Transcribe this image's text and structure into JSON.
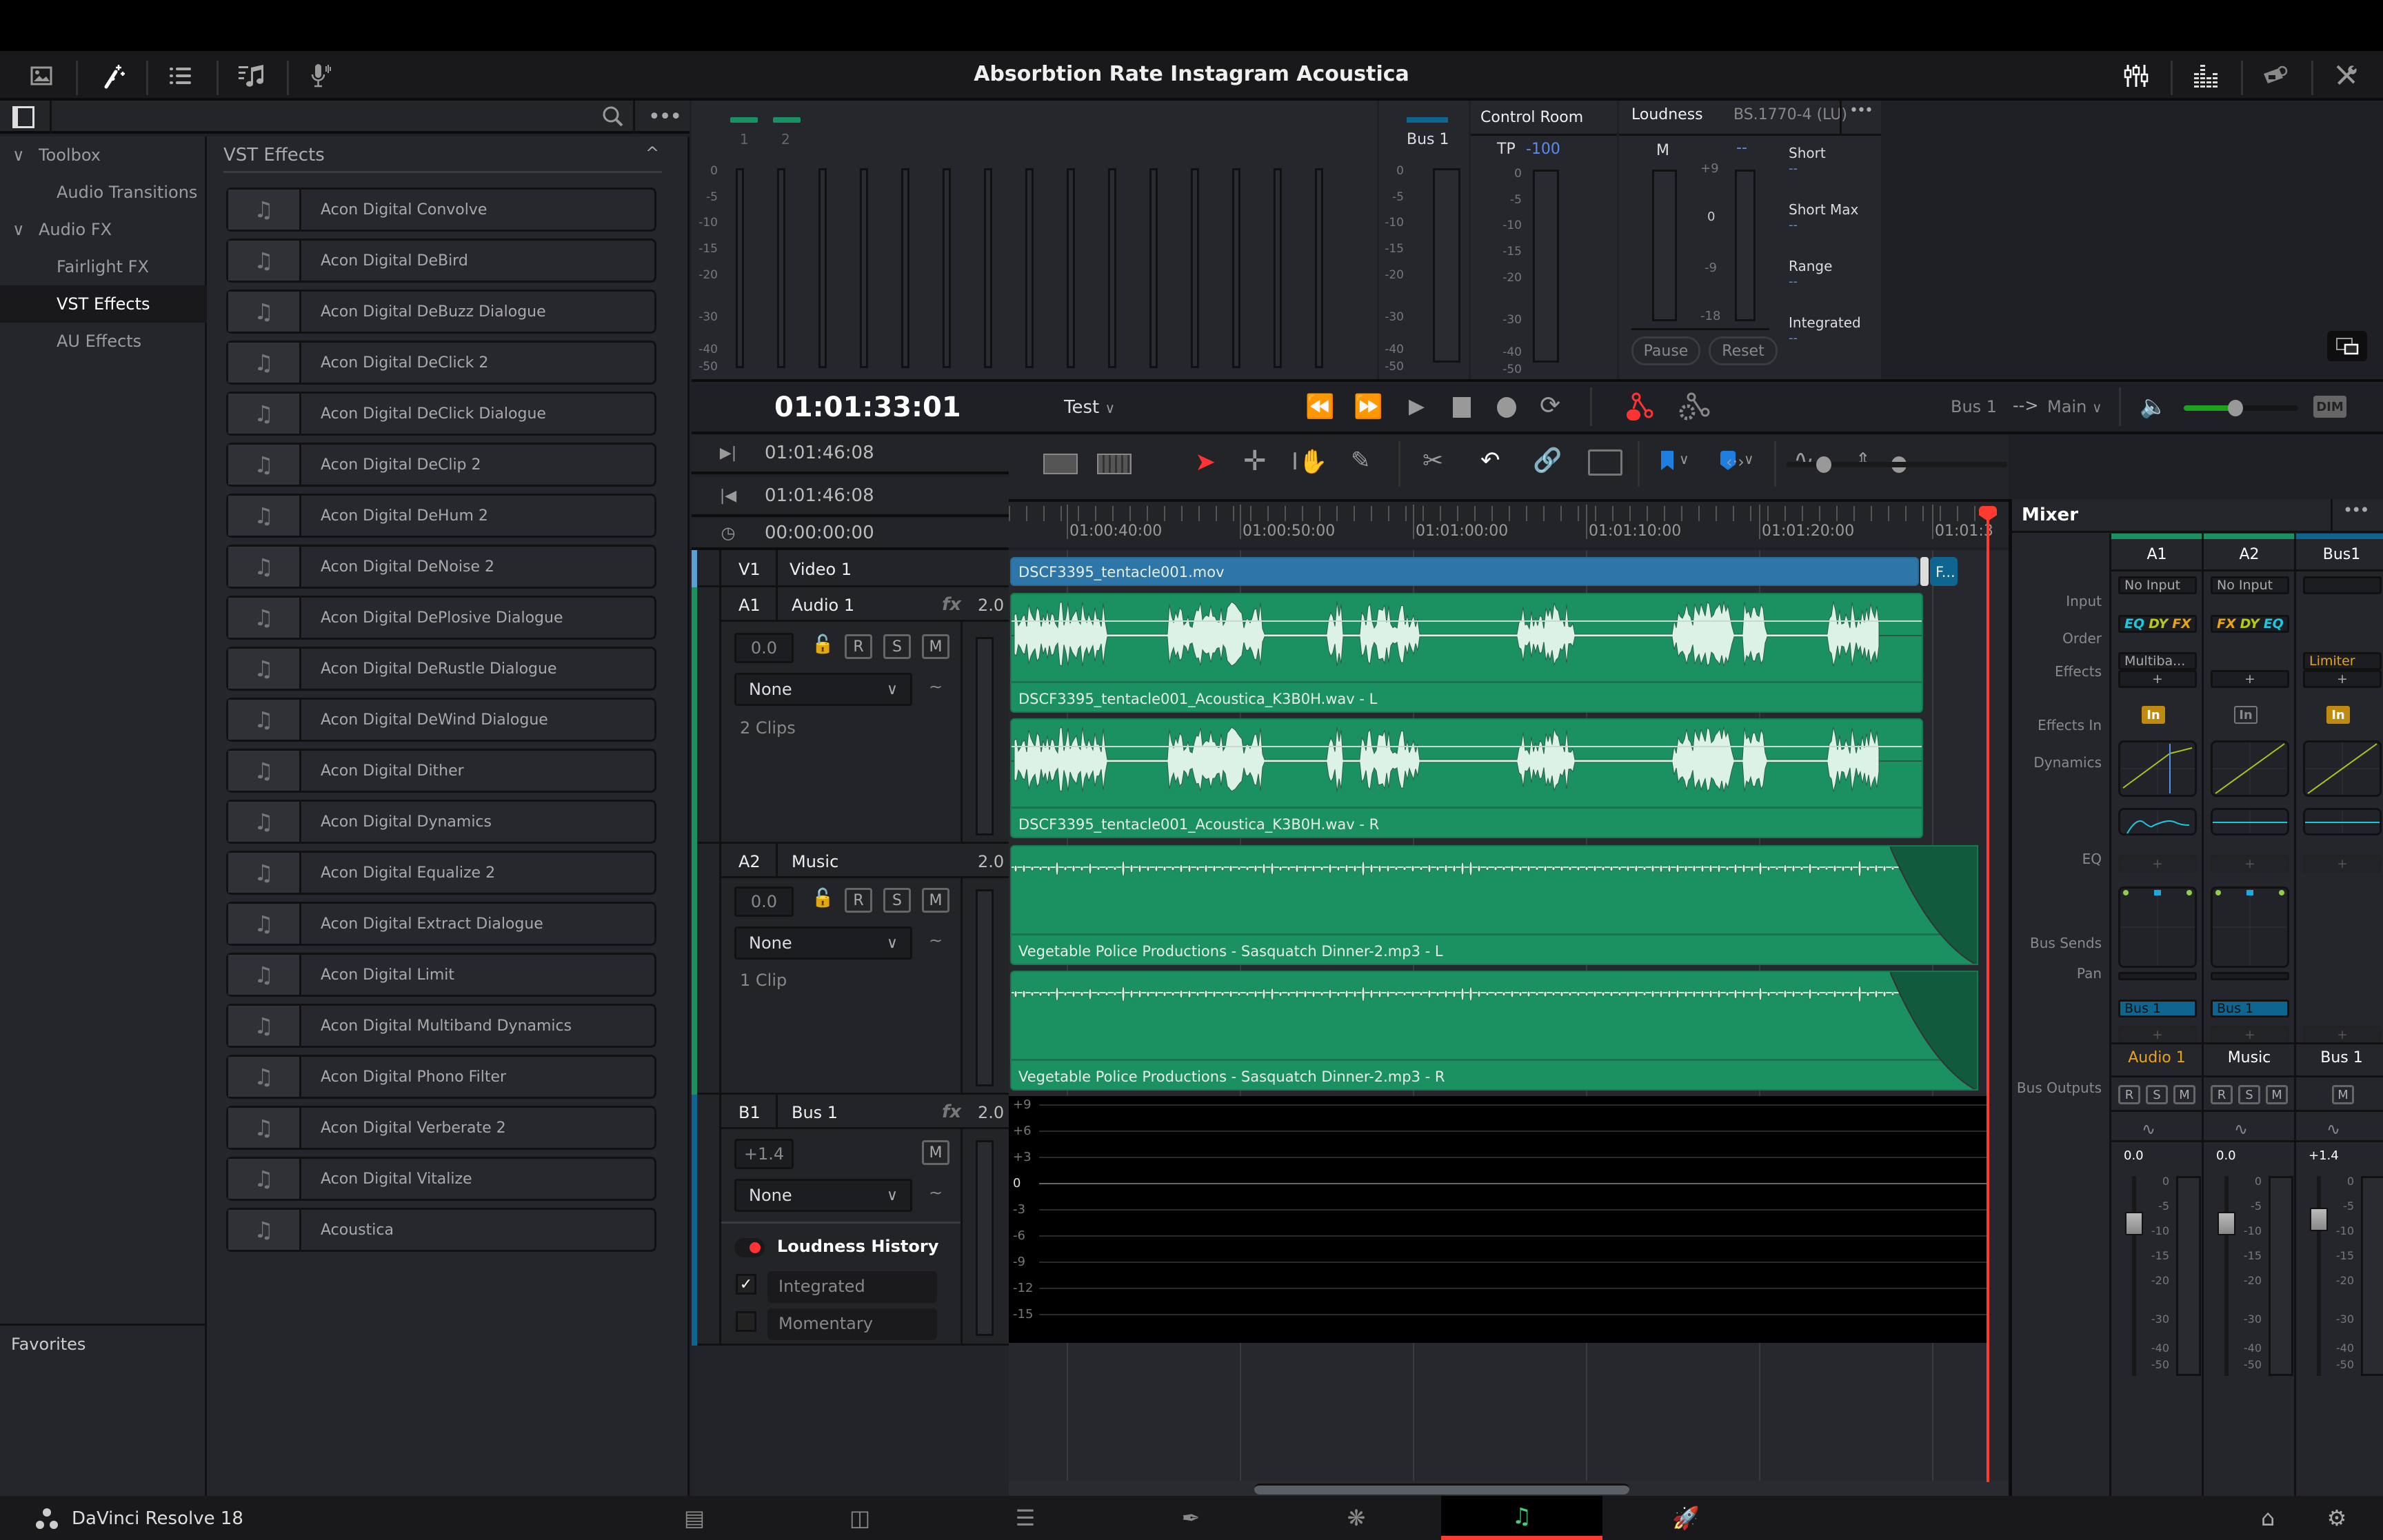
{
  "app": {
    "title": "Absorbtion Rate Instagram Acoustica",
    "product": "DaVinci Resolve 18"
  },
  "toolbar_left": [
    {
      "name": "media-pool-icon"
    },
    {
      "name": "effects-library-icon",
      "active": true
    },
    {
      "name": "index-icon"
    },
    {
      "name": "sound-library-icon"
    },
    {
      "name": "adr-icon"
    }
  ],
  "toolbar_right": [
    {
      "name": "mixer-icon",
      "active": true
    },
    {
      "name": "meters-icon",
      "active": true
    },
    {
      "name": "metadata-icon"
    },
    {
      "name": "inspector-icon"
    }
  ],
  "sidebar": {
    "items": [
      {
        "label": "Toolbox",
        "expandable": true,
        "chevron": "v"
      },
      {
        "label": "Audio Transitions"
      },
      {
        "label": "Audio FX",
        "expandable": true,
        "chevron": "v"
      },
      {
        "label": "Fairlight FX"
      },
      {
        "label": "VST Effects",
        "selected": true
      },
      {
        "label": "AU Effects"
      }
    ],
    "favorites_label": "Favorites"
  },
  "effects_list": {
    "header": "VST Effects",
    "collapse_glyph": "^",
    "items": [
      "Acon Digital Convolve",
      "Acon Digital DeBird",
      "Acon Digital DeBuzz Dialogue",
      "Acon Digital DeClick 2",
      "Acon Digital DeClick Dialogue",
      "Acon Digital DeClip 2",
      "Acon Digital DeHum 2",
      "Acon Digital DeNoise 2",
      "Acon Digital DePlosive Dialogue",
      "Acon Digital DeRustle Dialogue",
      "Acon Digital DeWind Dialogue",
      "Acon Digital Dither",
      "Acon Digital Dynamics",
      "Acon Digital Equalize 2",
      "Acon Digital Extract Dialogue",
      "Acon Digital Limit",
      "Acon Digital Multiband Dynamics",
      "Acon Digital Phono Filter",
      "Acon Digital Verberate 2",
      "Acon Digital Vitalize",
      "Acoustica"
    ]
  },
  "meters": {
    "track_labels": [
      "1",
      "2"
    ],
    "scale": [
      "0",
      "-5",
      "-10",
      "-15",
      "-20",
      "-30",
      "-40",
      "-50"
    ],
    "bus_label": "Bus 1",
    "control_room": {
      "label": "Control Room",
      "tp_label": "TP",
      "tp_value": "-100"
    },
    "loudness": {
      "label": "Loudness",
      "standard": "BS.1770-4 (LU)",
      "m_label": "M",
      "m_value": "--",
      "scale": [
        "+9",
        "0",
        "-9",
        "-18"
      ],
      "stats": [
        {
          "label": "Short",
          "value": "--"
        },
        {
          "label": "Short Max",
          "value": "--"
        },
        {
          "label": "Range",
          "value": "--"
        },
        {
          "label": "Integrated",
          "value": "--"
        }
      ],
      "pause_label": "Pause",
      "reset_label": "Reset"
    }
  },
  "transport": {
    "timecode": "01:01:33:01",
    "timeline_name": "Test",
    "route_from": "Bus 1",
    "route_arrow": "-->",
    "route_to": "Main",
    "dim_label": "DIM",
    "monitor_volume_fraction": 0.45
  },
  "timecodes": {
    "in": "01:01:46:08",
    "out": "01:01:46:08",
    "duration": "00:00:00:00"
  },
  "ruler": {
    "labels": [
      "01:00:40:00",
      "01:00:50:00",
      "01:01:00:00",
      "01:01:10:00",
      "01:01:20:00",
      "01:01:3"
    ]
  },
  "tracks": [
    {
      "id": "V1",
      "name": "Video 1",
      "color": "#5a9fd4"
    },
    {
      "id": "A1",
      "name": "Audio 1",
      "fx": "fx",
      "format": "2.0",
      "volume": "0.0",
      "automation": "None",
      "clips_label": "2 Clips",
      "color": "#1b9060"
    },
    {
      "id": "A2",
      "name": "Music",
      "format": "2.0",
      "volume": "0.0",
      "automation": "None",
      "clips_label": "1 Clip",
      "color": "#1b9060"
    },
    {
      "id": "B1",
      "name": "Bus 1",
      "fx": "fx",
      "format": "2.0",
      "volume": "+1.4",
      "automation": "None",
      "color": "#0e6690"
    }
  ],
  "track_buttons": {
    "r": "R",
    "s": "S",
    "m": "M"
  },
  "loudness_history": {
    "title": "Loudness History",
    "options": [
      {
        "label": "Integrated",
        "checked": true
      },
      {
        "label": "Momentary",
        "checked": false
      }
    ],
    "scale": [
      "+9",
      "+6",
      "+3",
      "0",
      "-3",
      "-6",
      "-9",
      "-12",
      "-15"
    ]
  },
  "clips": {
    "video": "DSCF3395_tentacle001.mov",
    "video_tail": "F...1",
    "a1_l": "DSCF3395_tentacle001_Acoustica_K3B0H.wav - L",
    "a1_r": "DSCF3395_tentacle001_Acoustica_K3B0H.wav - R",
    "a2_l": "Vegetable Police Productions - Sasquatch Dinner-2.mp3 - L",
    "a2_r": "Vegetable Police Productions - Sasquatch Dinner-2.mp3 - R"
  },
  "mixer": {
    "title": "Mixer",
    "row_labels": [
      "Input",
      "Order",
      "Effects",
      "Effects In",
      "Dynamics",
      "EQ",
      "Bus Sends",
      "Pan",
      "Bus Outputs"
    ],
    "channels": [
      {
        "id": "A1",
        "input": "No Input",
        "order": [
          "EQ",
          "DY",
          "FX"
        ],
        "effect": "Multiba...",
        "effects_in": "In",
        "effects_in_active": true,
        "bus_output": "Bus 1",
        "name": "Audio 1",
        "name_color": "#e8a317",
        "buttons": [
          "R",
          "S",
          "M"
        ],
        "fader_value": "0.0",
        "color": "#1b9060"
      },
      {
        "id": "A2",
        "input": "No Input",
        "order": [
          "FX",
          "DY",
          "EQ"
        ],
        "effect": "",
        "effects_in": "In",
        "effects_in_active": false,
        "bus_output": "Bus 1",
        "name": "Music",
        "name_color": "#ffffff",
        "buttons": [
          "R",
          "S",
          "M"
        ],
        "fader_value": "0.0",
        "color": "#1b9060"
      },
      {
        "id": "Bus1",
        "input": "",
        "order": [],
        "effect": "Limiter",
        "effects_in": "In",
        "effects_in_active": true,
        "bus_output": "",
        "name": "Bus 1",
        "name_color": "#ffffff",
        "buttons": [
          "M"
        ],
        "fader_value": "+1.4",
        "color": "#0e6690"
      }
    ],
    "fader_scale": [
      "0",
      "-5",
      "-10",
      "-15",
      "-20",
      "-30",
      "-40",
      "-50"
    ],
    "plus": "+"
  },
  "colors": {
    "order_eq": "#1ec8e0",
    "order_dy": "#b8c81a",
    "order_fx": "#e8a317",
    "playhead": "#ff3b30",
    "clip_green": "#1b9060",
    "clip_blue": "#2e76a8",
    "bus_blue": "#0e6690"
  },
  "footer_pages": [
    {
      "name": "media-page-icon"
    },
    {
      "name": "cut-page-icon"
    },
    {
      "name": "edit-page-icon"
    },
    {
      "name": "fusion-page-icon"
    },
    {
      "name": "color-page-icon"
    },
    {
      "name": "fairlight-page-icon",
      "active": true
    },
    {
      "name": "deliver-page-icon"
    }
  ]
}
